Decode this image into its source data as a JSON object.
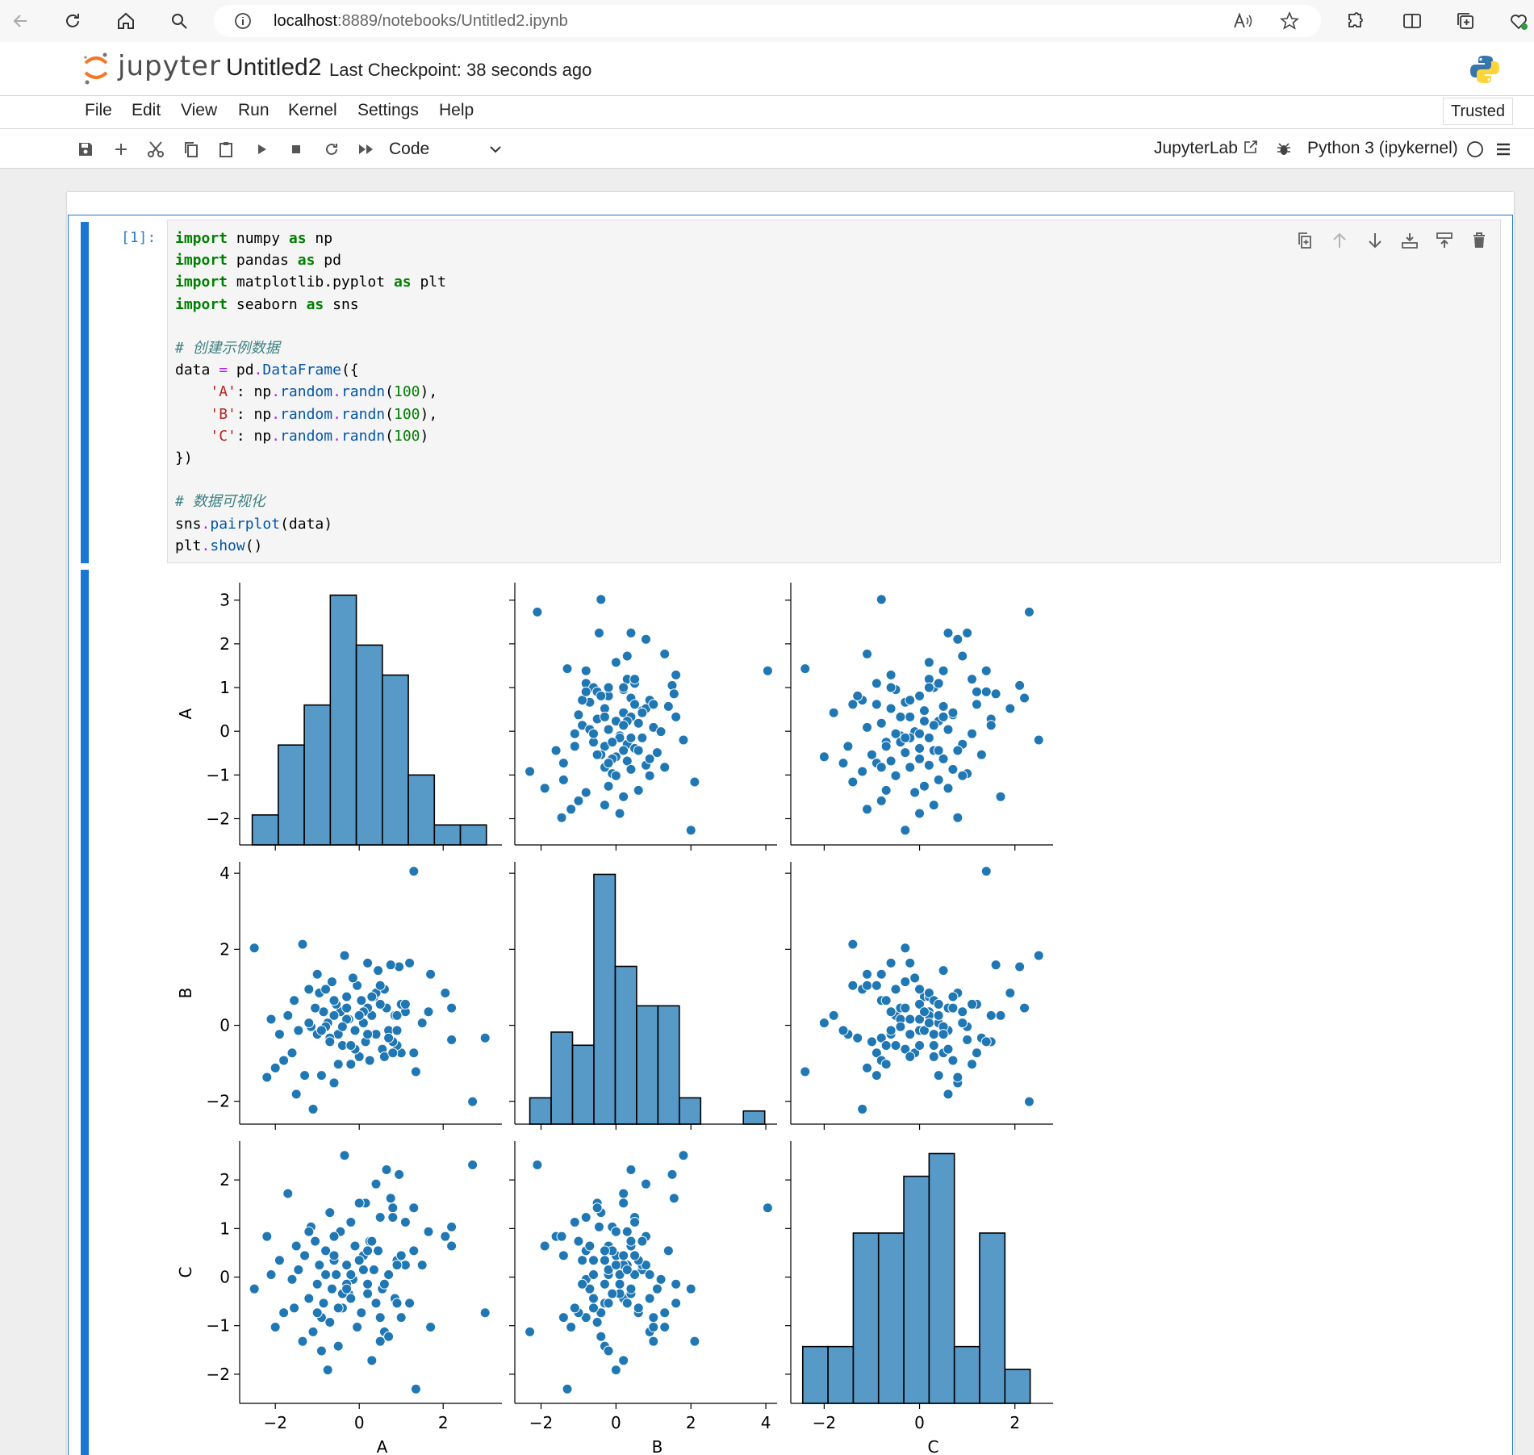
{
  "browser": {
    "url_host": "localhost",
    "url_path": ":8889/notebooks/Untitled2.ipynb"
  },
  "header": {
    "logo_text": "jupyter",
    "title": "Untitled2",
    "checkpoint": "Last Checkpoint: 38 seconds ago"
  },
  "menu": {
    "items": [
      "File",
      "Edit",
      "View",
      "Run",
      "Kernel",
      "Settings",
      "Help"
    ],
    "trusted": "Trusted"
  },
  "toolbar": {
    "cell_type": "Code",
    "jupyterlab_label": "JupyterLab",
    "kernel": "Python 3 (ipykernel)"
  },
  "cell": {
    "prompt": "[1]:",
    "code_lines": [
      "import numpy as np",
      "import pandas as pd",
      "import matplotlib.pyplot as plt",
      "import seaborn as sns",
      "",
      "# 创建示例数据",
      "data = pd.DataFrame({",
      "    'A': np.random.randn(100),",
      "    'B': np.random.randn(100),",
      "    'C': np.random.randn(100)",
      "})",
      "",
      "# 数据可视化",
      "sns.pairplot(data)",
      "plt.show()"
    ]
  },
  "chart_data": {
    "type": "scatter",
    "variables": [
      "A",
      "B",
      "C"
    ],
    "color": "#1f77b4",
    "axes": {
      "A": {
        "range": [
          -2.85,
          3.4
        ],
        "ticks": [
          -2,
          0,
          2
        ],
        "row_range": [
          -2.6,
          3.4
        ],
        "row_ticks": [
          -2,
          -1,
          0,
          1,
          2,
          3
        ]
      },
      "B": {
        "range": [
          -2.7,
          4.3
        ],
        "ticks": [
          -2,
          0,
          2,
          4
        ],
        "row_range": [
          -2.6,
          4.3
        ],
        "row_ticks": [
          -2,
          0,
          2,
          4
        ]
      },
      "C": {
        "range": [
          -2.7,
          2.8
        ],
        "ticks": [
          -2,
          0,
          2
        ],
        "row_range": [
          -2.6,
          2.8
        ],
        "row_ticks": [
          -2,
          -1,
          0,
          1,
          2
        ]
      }
    },
    "histograms": {
      "A": {
        "edges": [
          -2.55,
          -1.93,
          -1.31,
          -0.69,
          -0.07,
          0.55,
          1.17,
          1.79,
          2.41,
          3.03
        ],
        "counts": [
          3,
          10,
          14,
          25,
          20,
          17,
          7,
          2,
          2
        ]
      },
      "B": {
        "edges": [
          -2.3,
          -1.73,
          -1.16,
          -0.59,
          -0.02,
          0.55,
          1.12,
          1.69,
          2.26,
          2.83,
          3.4,
          3.97
        ],
        "counts": [
          2,
          7,
          6,
          19,
          12,
          9,
          9,
          2,
          0,
          0,
          1
        ]
      },
      "C": {
        "edges": [
          -2.45,
          -1.92,
          -1.39,
          -0.86,
          -0.33,
          0.2,
          0.73,
          1.26,
          1.79,
          2.32
        ],
        "counts": [
          5,
          5,
          15,
          15,
          20,
          22,
          5,
          15,
          3
        ]
      }
    },
    "points": {
      "A": [
        3.0,
        2.7,
        2.2,
        2.2,
        2.05,
        1.7,
        1.65,
        1.35,
        1.3,
        1.1,
        1.0,
        0.95,
        0.9,
        0.85,
        0.75,
        0.7,
        0.65,
        0.6,
        0.55,
        0.5,
        0.45,
        0.4,
        0.35,
        0.3,
        0.25,
        0.2,
        0.15,
        0.1,
        0.05,
        0.0,
        -0.05,
        -0.1,
        -0.15,
        -0.2,
        -0.25,
        -0.3,
        -0.35,
        -0.4,
        -0.45,
        -0.5,
        -0.55,
        -0.6,
        -0.65,
        -0.7,
        -0.75,
        -0.8,
        -0.85,
        -0.9,
        -0.95,
        -1.0,
        -1.05,
        -1.1,
        -1.15,
        -1.2,
        -1.3,
        -1.35,
        -1.45,
        -1.5,
        -1.55,
        -1.6,
        -1.7,
        -1.8,
        -1.9,
        -2.0,
        -2.1,
        -2.2,
        -2.5,
        1.3,
        1.2,
        0.9,
        0.8,
        0.5,
        0.2,
        -0.1,
        -0.3,
        -0.6,
        -0.9,
        -1.2,
        -0.2,
        0.1,
        0.4,
        0.7,
        1.0,
        -0.5,
        -0.8,
        0.6,
        0.0,
        -0.4,
        0.3,
        -0.7,
        1.5,
        -1.0,
        0.8,
        -0.3,
        0.2,
        0.5,
        -0.2,
        -0.6,
        0.9,
        1.1
      ],
      "B": [
        -0.4,
        -2.1,
        0.4,
        -0.45,
        0.8,
        1.3,
        0.3,
        -1.3,
        4.05,
        0.3,
        -0.8,
        1.5,
        -0.6,
        0.2,
        1.55,
        -0.2,
        0.4,
        0.9,
        -0.7,
        0.5,
        1.4,
        -0.3,
        0.7,
        0.2,
        -1.0,
        1.6,
        -0.5,
        0.0,
        0.6,
        -0.9,
        1.0,
        -0.2,
        1.2,
        -1.1,
        0.1,
        0.7,
        1.8,
        -0.6,
        0.3,
        -0.3,
        0.5,
        -1.6,
        1.1,
        -0.4,
        0.0,
        -0.1,
        0.3,
        -1.4,
        0.8,
        -0.3,
        0.4,
        -2.3,
        -0.1,
        0.9,
        -1.4,
        2.1,
        -0.2,
        -1.9,
        0.6,
        -0.8,
        0.2,
        -1.0,
        -0.3,
        -1.2,
        0.1,
        -1.45,
        2.0,
        -0.8,
        1.6,
        0.2,
        -0.5,
        1.0,
        0.4,
        -0.7,
        0.1,
        0.6,
        -0.2,
        0.0,
        -0.6,
        0.3,
        0.8,
        -0.4,
        0.5,
        -1.1,
        0.9,
        -0.9,
        0.2,
        -0.1,
        0.7,
        -0.5,
        0.0,
        1.3,
        -0.8,
        0.4,
        -0.3,
        1.0,
        -0.6,
        0.2,
        -0.2,
        0.5
      ],
      "C": [
        -0.8,
        2.3,
        0.6,
        1.0,
        0.8,
        -1.1,
        0.9,
        -2.4,
        1.4,
        0.2,
        -0.9,
        2.1,
        0.3,
        -0.5,
        1.6,
        0.0,
        2.2,
        -1.2,
        -0.3,
        1.2,
        0.5,
        -0.6,
        0.1,
        -1.8,
        0.7,
        -0.2,
        1.5,
        0.4,
        -0.8,
        0.3,
        -1.1,
        0.6,
        -0.1,
        1.1,
        -0.4,
        0.2,
        2.5,
        -0.7,
        0.9,
        -1.5,
        0.0,
        0.8,
        -0.3,
        1.3,
        -2.0,
        0.5,
        -0.6,
        -0.9,
        0.2,
        -0.2,
        0.7,
        -1.2,
        1.0,
        -0.5,
        0.4,
        -1.4,
        0.1,
        0.6,
        -0.7,
        -0.1,
        1.7,
        -0.8,
        0.3,
        -1.1,
        0.0,
        0.8,
        -0.3,
        0.5,
        -0.6,
        0.2,
        1.4,
        -0.9,
        -0.4,
        0.6,
        -0.2,
        0.3,
        -1.6,
        0.9,
        -0.5,
        0.1,
        1.9,
        -1.3,
        0.4,
        -0.7,
        0.0,
        -0.2,
        1.5,
        -0.4,
        0.7,
        -1.0,
        0.2,
        -0.8,
        1.2,
        -0.3,
        0.5,
        -1.4,
        0.0,
        0.4,
        -0.6,
        1.1
      ]
    }
  }
}
